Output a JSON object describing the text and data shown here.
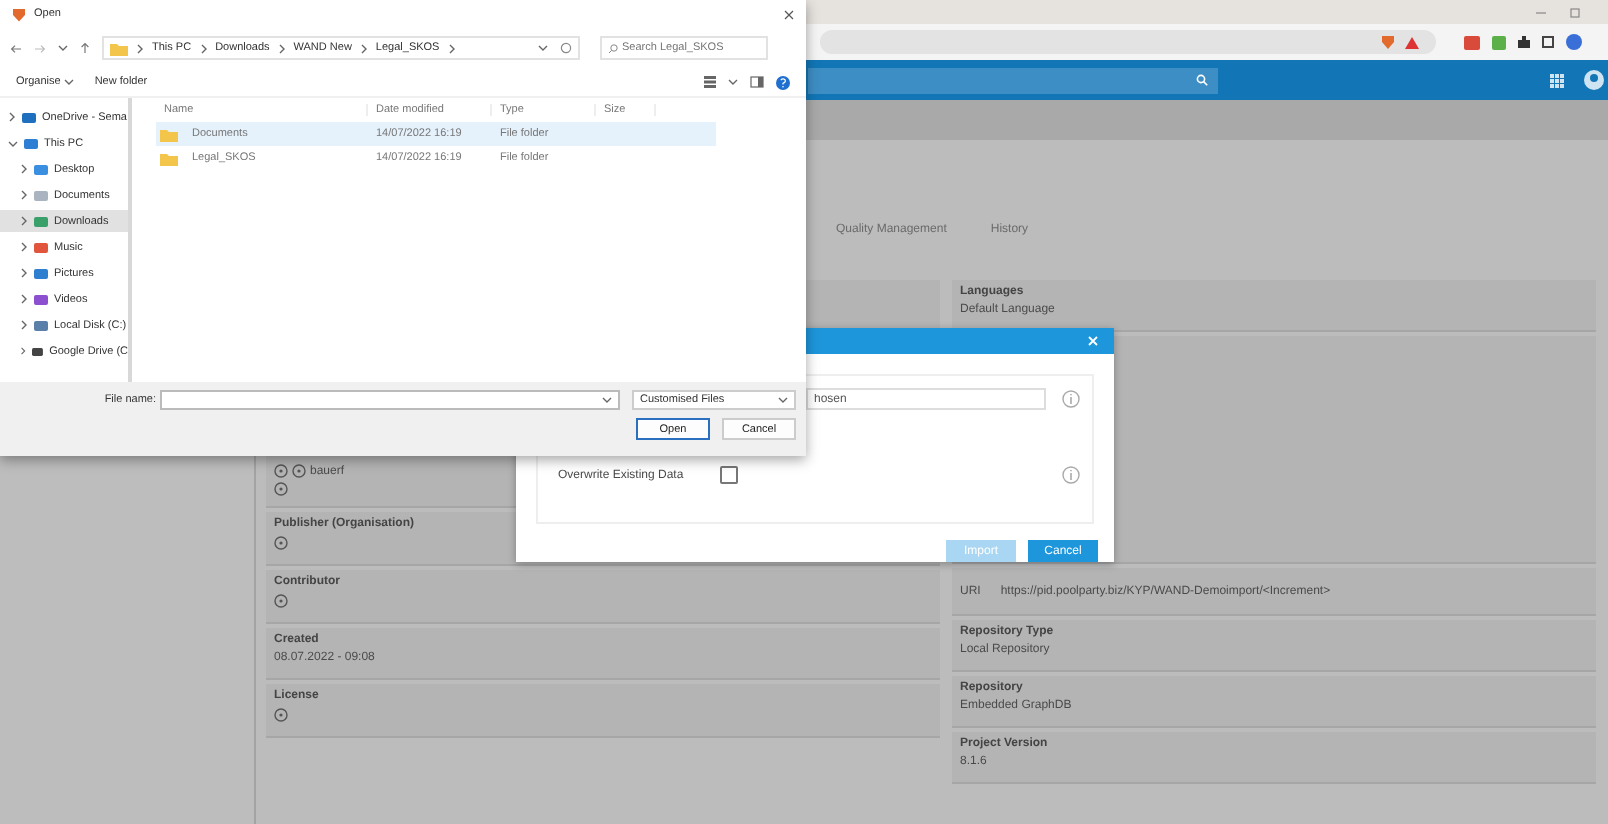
{
  "tabs": [
    {
      "label": "Quality Management",
      "selected": false
    },
    {
      "label": "History",
      "selected": false
    }
  ],
  "left_cards": [
    {
      "kind": "hidden"
    },
    {
      "kind": "author",
      "value": "bauerf"
    },
    {
      "kind": "empty",
      "label": "Publisher (Organisation)"
    },
    {
      "kind": "empty",
      "label": "Contributor"
    },
    {
      "kind": "text",
      "label": "Created",
      "value": "08.07.2022 - 09:08"
    },
    {
      "kind": "empty",
      "label": "License"
    }
  ],
  "right_cards": [
    {
      "kind": "text",
      "label": "Languages",
      "value": "Default Language"
    },
    {
      "kind": "hidden"
    },
    {
      "kind": "uri",
      "label": "URI",
      "value": "https://pid.poolparty.biz/KYP/WAND-Demoimport/<Increment>"
    },
    {
      "kind": "text",
      "label": "Repository Type",
      "value": "Local Repository"
    },
    {
      "kind": "text",
      "label": "Repository",
      "value": "Embedded GraphDB"
    },
    {
      "kind": "text",
      "label": "Project Version",
      "value": "8.1.6"
    }
  ],
  "import_dialog": {
    "file_field": {
      "value": "hosen"
    },
    "overwrite": {
      "label": "Overwrite Existing Data",
      "checked": false
    },
    "buttons": [
      {
        "label": "Import",
        "disabled": true
      },
      {
        "label": "Cancel",
        "disabled": false
      }
    ]
  },
  "file_dialog": {
    "title": "Open",
    "breadcrumb": [
      "This PC",
      "Downloads",
      "WAND New",
      "Legal_SKOS"
    ],
    "search": {
      "placeholder": "Search Legal_SKOS"
    },
    "toolbar": [
      "Organise",
      "New folder"
    ],
    "nav": [
      {
        "label": "OneDrive - Sema",
        "kind": "cloud",
        "expanded": false,
        "selected": false
      },
      {
        "label": "This PC",
        "kind": "pc",
        "expanded": true,
        "selected": false,
        "children": [
          {
            "label": "Desktop",
            "kind": "desktop",
            "expanded": false,
            "selected": false
          },
          {
            "label": "Documents",
            "kind": "doc",
            "expanded": false,
            "selected": false
          },
          {
            "label": "Downloads",
            "kind": "download",
            "expanded": false,
            "selected": true
          },
          {
            "label": "Music",
            "kind": "music",
            "expanded": false,
            "selected": false
          },
          {
            "label": "Pictures",
            "kind": "pictures",
            "expanded": false,
            "selected": false
          },
          {
            "label": "Videos",
            "kind": "videos",
            "expanded": false,
            "selected": false
          },
          {
            "label": "Local Disk (C:)",
            "kind": "disk",
            "expanded": false,
            "selected": false
          },
          {
            "label": "Google Drive (C",
            "kind": "drive",
            "expanded": false,
            "selected": false
          }
        ]
      }
    ],
    "columns": [
      "Name",
      "Date modified",
      "Type",
      "Size"
    ],
    "rows": [
      {
        "name": "Documents",
        "date": "14/07/2022 16:19",
        "type": "File folder",
        "selected": true
      },
      {
        "name": "Legal_SKOS",
        "date": "14/07/2022 16:19",
        "type": "File folder",
        "selected": false
      }
    ],
    "file_name_label": "File name:",
    "filter": "Customised Files",
    "buttons": [
      "Open",
      "Cancel"
    ]
  }
}
